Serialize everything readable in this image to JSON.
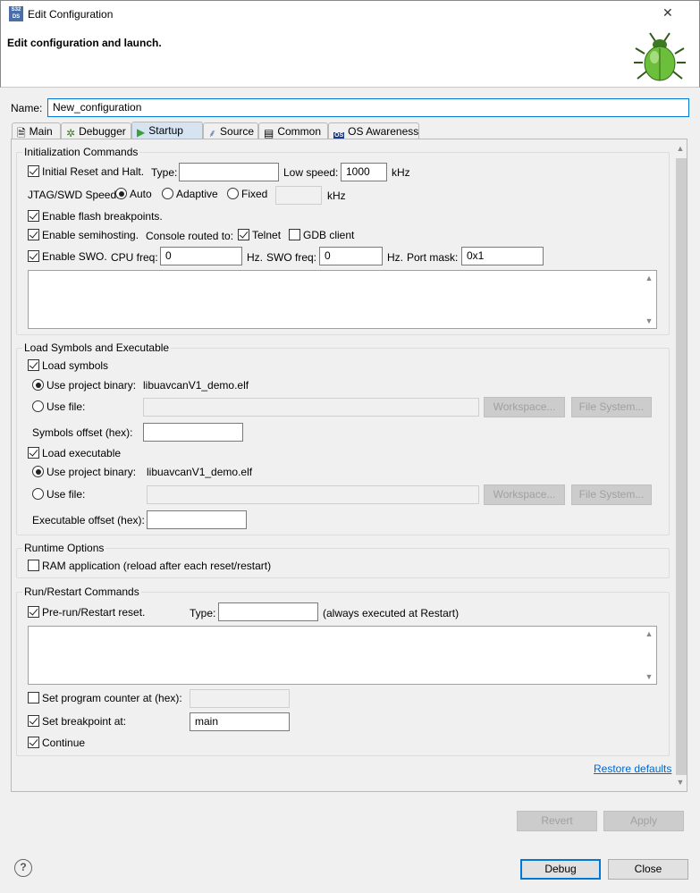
{
  "window": {
    "title": "Edit Configuration",
    "logo_text": "S32 DS",
    "close": "✕"
  },
  "header": {
    "message": "Edit configuration and launch."
  },
  "name": {
    "label": "Name:",
    "value": "New_configuration"
  },
  "tabs": [
    {
      "label": "Main"
    },
    {
      "label": "Debugger"
    },
    {
      "label": "Startup"
    },
    {
      "label": "Source"
    },
    {
      "label": "Common"
    },
    {
      "label": "OS Awareness"
    }
  ],
  "init": {
    "title": "Initialization Commands",
    "reset_halt": "Initial Reset and Halt.",
    "type_label": "Type:",
    "type_value": "",
    "low_speed_label": "Low speed:",
    "low_speed_value": "1000",
    "khz": "kHz",
    "jtag_label": "JTAG/SWD Speed:",
    "auto": "Auto",
    "adaptive": "Adaptive",
    "fixed": "Fixed",
    "fixed_value": "",
    "flash_bp": "Enable flash breakpoints.",
    "semihosting": "Enable semihosting.",
    "console_label": "Console routed to:",
    "telnet": "Telnet",
    "gdb_client": "GDB client",
    "swo": "Enable SWO.",
    "cpu_freq_label": "CPU freq:",
    "cpu_freq": "0",
    "hz": "Hz.",
    "swo_freq_label": "SWO freq:",
    "swo_freq": "0",
    "port_mask_label": "Port mask:",
    "port_mask": "0x1"
  },
  "load": {
    "title": "Load Symbols and Executable",
    "load_symbols": "Load symbols",
    "use_project_binary": "Use project binary:",
    "binary": "libuavcanV1_demo.elf",
    "use_file": "Use file:",
    "workspace": "Workspace...",
    "file_system": "File System...",
    "symbols_offset": "Symbols offset (hex):",
    "load_executable": "Load executable",
    "exec_offset": "Executable offset (hex):"
  },
  "runtime": {
    "title": "Runtime Options",
    "ram_app": "RAM application (reload after each reset/restart)"
  },
  "run": {
    "title": "Run/Restart Commands",
    "pre_run": "Pre-run/Restart reset.",
    "type_label": "Type:",
    "note": "(always executed at Restart)",
    "set_pc": "Set program counter at (hex):",
    "set_bp": "Set breakpoint at:",
    "bp_value": "main",
    "continue": "Continue"
  },
  "restore_defaults": "Restore defaults",
  "buttons": {
    "revert": "Revert",
    "apply": "Apply",
    "debug": "Debug",
    "close": "Close",
    "help": "?"
  }
}
